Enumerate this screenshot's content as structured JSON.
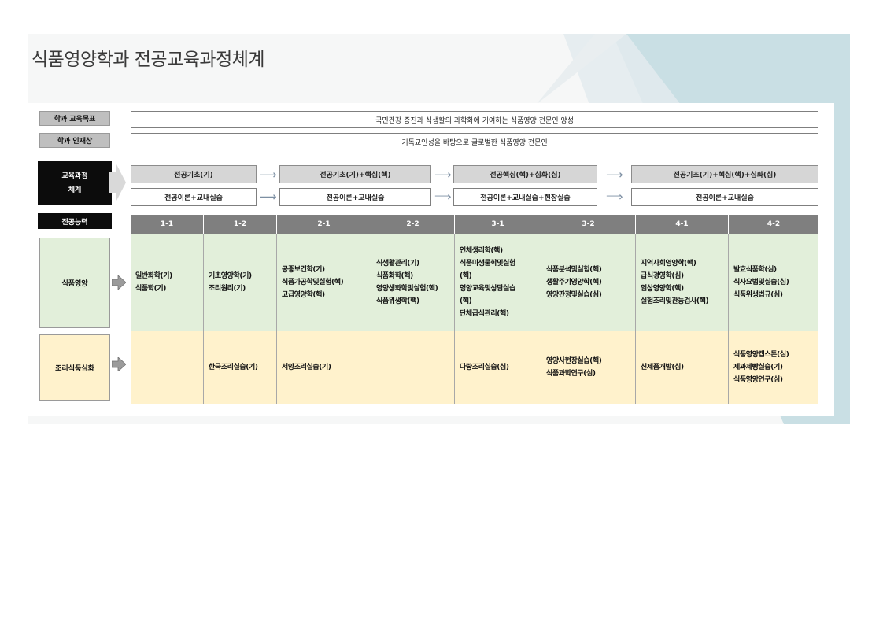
{
  "title": "식품영양학과 전공교육과정체계",
  "rows": {
    "goal": {
      "label": "학과 교육목표",
      "text": "국민건강 증진과 식생활의 과학화에 기여하는 식품영양 전문인 양성"
    },
    "talent": {
      "label": "학과 인재상",
      "text": "기독교인성을 바탕으로 글로벌한 식품영양 전문인"
    }
  },
  "system": {
    "label_line1": "교육과정",
    "label_line2": "체계",
    "stages_top": [
      "전공기초(기)",
      "전공기초(기)+핵심(핵)",
      "전공핵심(핵)+심화(심)",
      "전공기초(기)+핵심(핵)+심화(심)"
    ],
    "stages_bottom": [
      "전공이론+교내실습",
      "전공이론+교내실습",
      "전공이론+교내실습+현장실습",
      "전공이론+교내실습"
    ]
  },
  "competency": {
    "label": "전공능력",
    "semesters": [
      "1-1",
      "1-2",
      "2-1",
      "2-2",
      "3-1",
      "3-2",
      "4-1",
      "4-2"
    ]
  },
  "tracks": [
    {
      "label": "식품영양",
      "color": "#e2efda",
      "courses": [
        [
          "일반화학(기)",
          "식품학(기)"
        ],
        [
          "기초영양학(기)",
          "조리원리(기)"
        ],
        [
          "공중보건학(기)",
          "식품가공학및실험(핵)",
          "고급영양학(핵)"
        ],
        [
          "식생활관리(기)",
          "식품화학(핵)",
          "영양생화학및실험(핵)",
          "식품위생학(핵)"
        ],
        [
          "인체생리학(핵)",
          "식품미생물학및실험",
          "(핵)",
          "영양교육및상담실습",
          "(핵)",
          "단체급식관리(핵)"
        ],
        [
          "식품분석및실험(핵)",
          "생활주기영양학(핵)",
          "영양판정및실습(심)"
        ],
        [
          "지역사회영양학(핵)",
          "급식경영학(심)",
          "임상영양학(핵)",
          "실험조리및관능검사(핵)"
        ],
        [
          "발효식품학(심)",
          "식사요법및실습(심)",
          "식품위생법규(심)"
        ]
      ]
    },
    {
      "label": "조리식품심화",
      "color": "#fff2cc",
      "courses": [
        [],
        [
          "한국조리실습(기)"
        ],
        [
          "서양조리실습(기)"
        ],
        [],
        [
          "다량조리실습(심)"
        ],
        [
          "영양사현장실습(핵)",
          "식품과학연구(심)"
        ],
        [
          "신제품개발(심)"
        ],
        [
          "식품영양캡스톤(심)",
          "제과제빵실습(기)",
          "식품영양연구(심)"
        ]
      ]
    }
  ]
}
